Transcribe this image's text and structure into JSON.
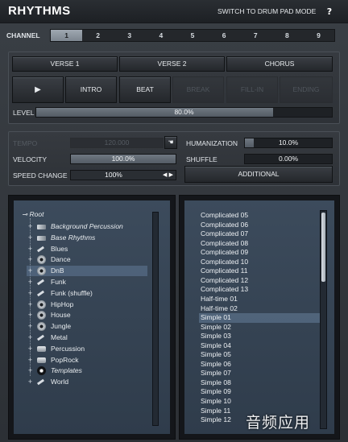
{
  "header": {
    "title": "RHYTHMS",
    "drum_mode_label": "SWITCH TO DRUM PAD MODE",
    "help_label": "?"
  },
  "channel": {
    "label": "CHANNEL",
    "items": [
      "1",
      "2",
      "3",
      "4",
      "5",
      "6",
      "7",
      "8",
      "9"
    ],
    "active_index": 0
  },
  "sections": {
    "verse1": "VERSE 1",
    "verse2": "VERSE 2",
    "chorus": "CHORUS",
    "play": "▶",
    "intro": "INTRO",
    "beat": "BEAT",
    "break": "BREAK",
    "ending": "ENDING",
    "fill_in": "FILL-IN"
  },
  "level": {
    "label": "LEVEL",
    "value": "80.0%",
    "fraction": 0.8
  },
  "params": {
    "tempo_label": "TEMPO",
    "tempo_value": "120.000",
    "humanization_label": "HUMANIZATION",
    "humanization_value": "10.0%",
    "humanization_fraction": 0.1,
    "velocity_label": "VELOCITY",
    "velocity_value": "100.0%",
    "velocity_fraction": 1.0,
    "shuffle_label": "SHUFFLE",
    "shuffle_value": "0.00%",
    "speed_change_label": "SPEED CHANGE",
    "speed_change_value": "100%",
    "additional_label": "ADDITIONAL"
  },
  "tree": {
    "root": "Root",
    "items": [
      {
        "label": "Background Percussion",
        "italic": true,
        "icon": "folder-icon"
      },
      {
        "label": "Base Rhythms",
        "italic": true,
        "icon": "folder-icon"
      },
      {
        "label": "Blues",
        "italic": false,
        "icon": "brush-icon"
      },
      {
        "label": "Dance",
        "italic": false,
        "icon": "disc-icon"
      },
      {
        "label": "DnB",
        "italic": false,
        "icon": "disc-icon",
        "selected": true
      },
      {
        "label": "Funk",
        "italic": false,
        "icon": "brush-icon"
      },
      {
        "label": "Funk (shuffle)",
        "italic": false,
        "icon": "brush-icon"
      },
      {
        "label": "HipHop",
        "italic": false,
        "icon": "disc-icon"
      },
      {
        "label": "House",
        "italic": false,
        "icon": "disc-icon"
      },
      {
        "label": "Jungle",
        "italic": false,
        "icon": "disc-icon"
      },
      {
        "label": "Metal",
        "italic": false,
        "icon": "brush-icon"
      },
      {
        "label": "Percussion",
        "italic": false,
        "icon": "drum-icon"
      },
      {
        "label": "PopRock",
        "italic": false,
        "icon": "drum-icon"
      },
      {
        "label": "Templates",
        "italic": true,
        "icon": "star-icon"
      },
      {
        "label": "World",
        "italic": false,
        "icon": "brush-icon"
      }
    ]
  },
  "rhythm_list": {
    "items": [
      "Complicated 05",
      "Complicated 06",
      "Complicated 07",
      "Complicated 08",
      "Complicated 09",
      "Complicated 10",
      "Complicated 11",
      "Complicated 12",
      "Complicated 13",
      "Half-time 01",
      "Half-time 02",
      "Simple 01",
      "Simple 02",
      "Simple 03",
      "Simple 04",
      "Simple 05",
      "Simple 06",
      "Simple 07",
      "Simple 08",
      "Simple 09",
      "Simple 10",
      "Simple 11",
      "Simple 12"
    ],
    "selected_index": 11
  },
  "watermark": "音频应用",
  "colors": {
    "accent": "#7d8690",
    "list_bg": "#3c4b5c"
  }
}
